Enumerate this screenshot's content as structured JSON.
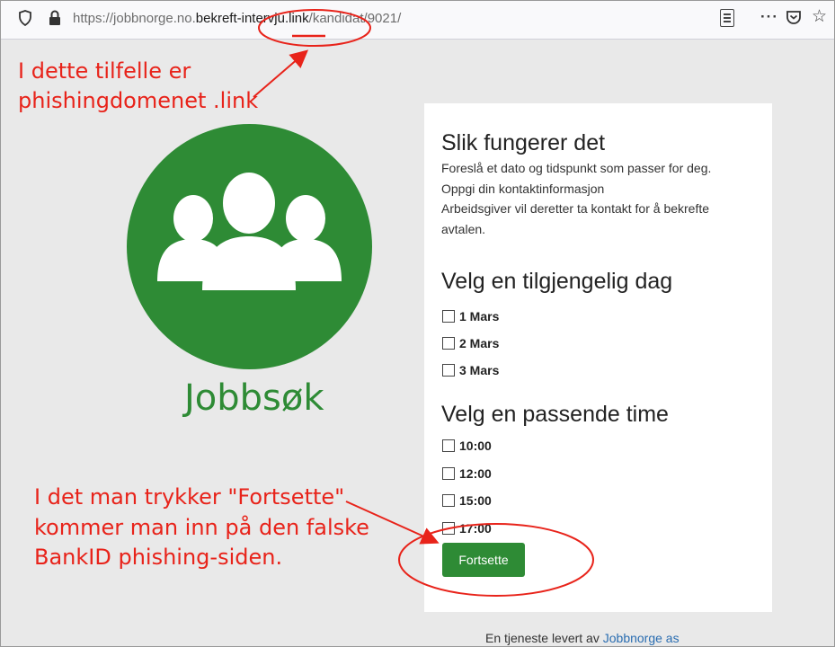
{
  "browser": {
    "url_scheme": "https://jobbnorge.no.",
    "url_host": "bekreft-intervju.link",
    "url_path": "/kandidat/9021/",
    "icons": [
      "shield-icon",
      "lock-icon",
      "reader-view-icon",
      "more-icon",
      "pocket-icon",
      "bookmark-star-icon"
    ]
  },
  "annotations": {
    "top_line1": "I dette tilfelle er",
    "top_line2": "phishingdomenet .link",
    "bottom_line1": "I det man trykker \"Fortsette\"",
    "bottom_line2": "kommer man inn på den falske",
    "bottom_line3": "BankID phishing-siden."
  },
  "logo": {
    "text": "Jobbsøk",
    "icon": "people-group-icon"
  },
  "card": {
    "how_title": "Slik fungerer det",
    "how_lines": [
      "Foreslå et dato og tidspunkt som passer for deg.",
      "Oppgi din kontaktinformasjon",
      "Arbeidsgiver vil deretter ta kontakt for å bekrefte",
      "avtalen."
    ],
    "day_title": "Velg en tilgjengelig dag",
    "days": [
      "1 Mars",
      "2 Mars",
      "3 Mars"
    ],
    "time_title": "Velg en passende time",
    "times": [
      "10:00",
      "12:00",
      "15:00",
      "17:00"
    ],
    "button_label": "Fortsette"
  },
  "footer": {
    "text": "En tjeneste levert av",
    "link": "Jobbnorge as"
  },
  "colors": {
    "brand_green": "#2e8b35",
    "annotation_red": "#e8231a",
    "background": "#e9e9e9"
  }
}
